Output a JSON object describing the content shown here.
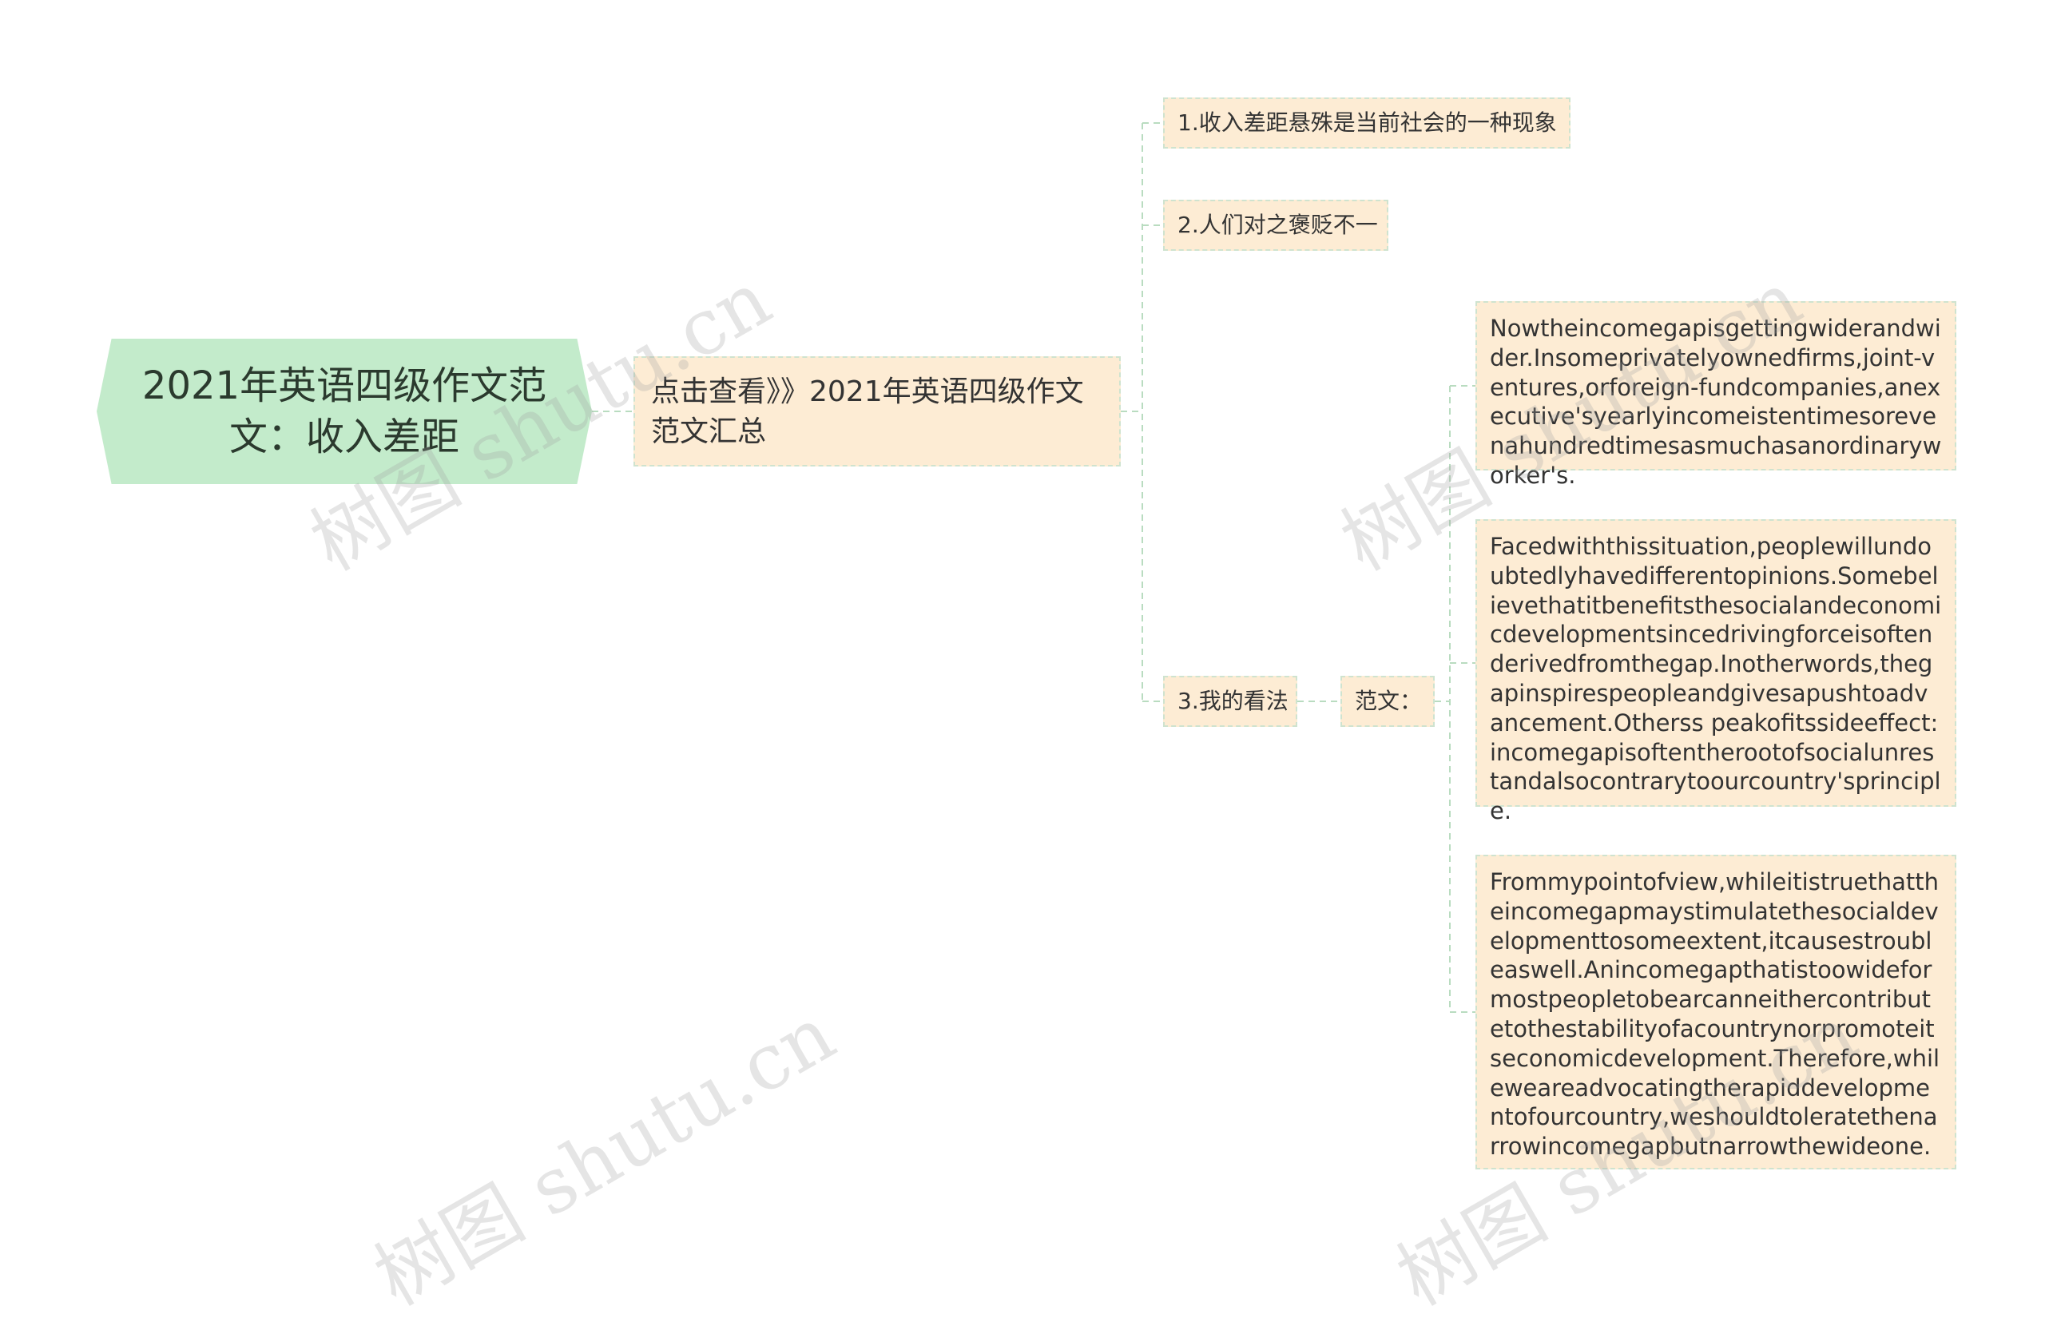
{
  "mindmap": {
    "root": {
      "text": "2021年英语四级作文范文：收入差距"
    },
    "branch": {
      "text": "点击查看》》2021年英语四级作文范文汇总"
    },
    "children": [
      {
        "text": "1.收入差距悬殊是当前社会的一种现象"
      },
      {
        "text": "2.人们对之褒贬不一"
      },
      {
        "text": "3.我的看法"
      }
    ],
    "sample_label": "范文：",
    "paragraphs": [
      "Nowtheincomegapisgettingwiderandwider.Insomeprivatelyownedfirms,joint-ventures,orforeign-fundcompanies,anexecutive'syearlyincomeistentimesorevenahundredtimesasmuchasanordinaryworker's.",
      "Facedwiththissituation,peoplewillundoubtedlyhavedifferentopinions.Somebelievethatitbenefitsthesocialandeconomicdevelopmentsincedrivingforceisoftenderivedfromthegap.Inotherwords,thegapinspirespeopleandgivesapushtoadvancement.Otherss peakofitssideeffect:incomegapisoftentherootofsocialunrestandalsocontrarytoourcountry'sprinciple.",
      "Frommypointofview,whileitistruethattheincomegapmaystimulatethesocialdevelopmenttosomeextent,itcausestroubleaswell.Anincomegapthatistoowideformostpeopletobearcanneithercontributetothestabilityofacountrynorpromoteitseconomicdevelopment.Therefore,whileweareadvocatingtherapiddevelopmentofourcountry,weshouldtoleratethenarrowincomegapbutnarrowthewideone."
    ]
  },
  "watermark": {
    "text": "树图 shutu.cn"
  },
  "colors": {
    "root_fill": "#c3ebcb",
    "node_fill": "#fdecd4",
    "node_border": "#cfe3cf",
    "connector": "#b9dcc0"
  }
}
